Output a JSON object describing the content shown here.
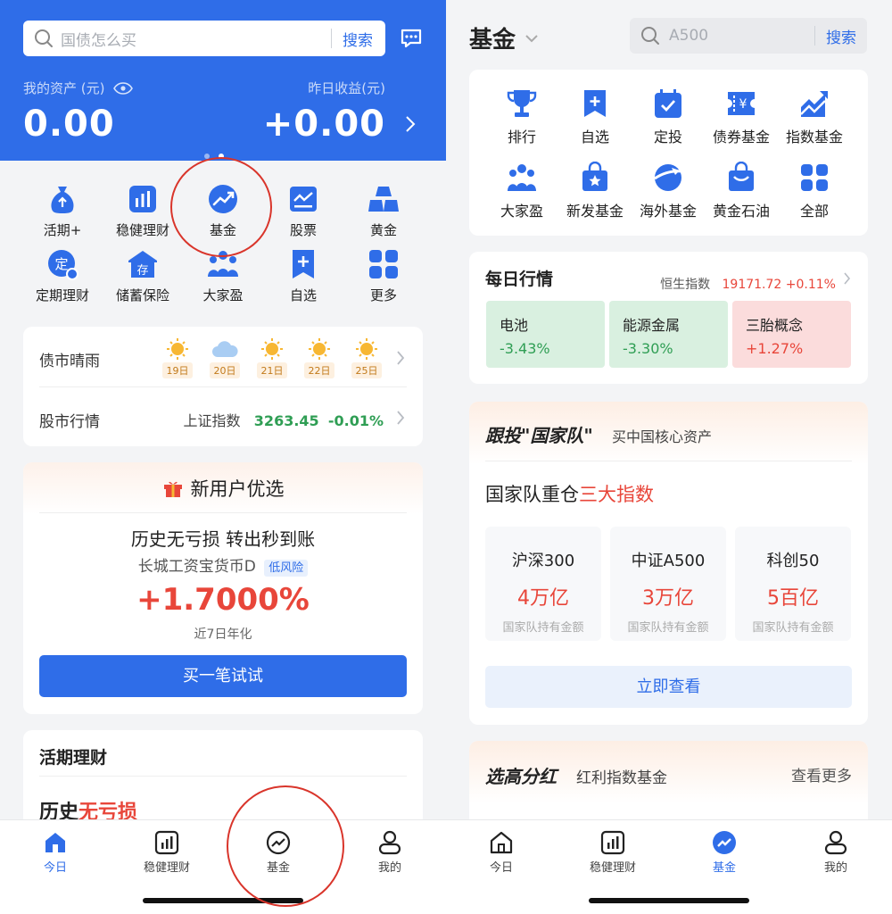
{
  "left": {
    "search": {
      "placeholder": "国债怎么买",
      "button": "搜索"
    },
    "assets": {
      "label": "我的资产 (元)",
      "value": "0.00",
      "yest_label": "昨日收益(元)",
      "yest_value": "+0.00"
    },
    "grid": [
      {
        "label": "活期+",
        "icon": "money-bag-icon"
      },
      {
        "label": "稳健理财",
        "icon": "bar-chart-icon"
      },
      {
        "label": "基金",
        "icon": "trend-icon"
      },
      {
        "label": "股票",
        "icon": "stock-chart-icon"
      },
      {
        "label": "黄金",
        "icon": "gold-bars-icon"
      },
      {
        "label": "定期理财",
        "icon": "fixed-term-icon"
      },
      {
        "label": "储蓄保险",
        "icon": "savings-house-icon"
      },
      {
        "label": "大家盈",
        "icon": "people-icon"
      },
      {
        "label": "自选",
        "icon": "bookmark-plus-icon"
      },
      {
        "label": "更多",
        "icon": "grid-more-icon"
      }
    ],
    "market": {
      "bond_label": "债市晴雨",
      "weather": [
        {
          "day": "19日",
          "w": "sunny"
        },
        {
          "day": "20日",
          "w": "cloudy"
        },
        {
          "day": "21日",
          "w": "sunny"
        },
        {
          "day": "22日",
          "w": "sunny"
        },
        {
          "day": "25日",
          "w": "sunny"
        }
      ],
      "stock_label": "股市行情",
      "index_name": "上证指数",
      "index_value": "3263.45",
      "index_change": "-0.01%"
    },
    "promo": {
      "title": "新用户优选",
      "headline": "历史无亏损 转出秒到账",
      "product": "长城工资宝货币D",
      "risk": "低风险",
      "rate": "+1.7000%",
      "rate_label": "近7日年化",
      "cta": "买一笔试试"
    },
    "current": {
      "title": "活期理财",
      "subtitle_a": "历史",
      "subtitle_b": "无亏损"
    },
    "tabs": [
      {
        "label": "今日",
        "active": true
      },
      {
        "label": "稳健理财"
      },
      {
        "label": "基金"
      },
      {
        "label": "我的"
      }
    ]
  },
  "right": {
    "title": "基金",
    "search": {
      "placeholder": "A500",
      "button": "搜索"
    },
    "grid": [
      {
        "label": "排行",
        "icon": "trophy-icon"
      },
      {
        "label": "自选",
        "icon": "bookmark-plus-icon"
      },
      {
        "label": "定投",
        "icon": "calendar-check-icon"
      },
      {
        "label": "债券基金",
        "icon": "bond-ticket-icon"
      },
      {
        "label": "指数基金",
        "icon": "index-chart-icon"
      },
      {
        "label": "大家盈",
        "icon": "people-icon"
      },
      {
        "label": "新发基金",
        "icon": "new-fund-bag-icon"
      },
      {
        "label": "海外基金",
        "icon": "globe-plane-icon"
      },
      {
        "label": "黄金石油",
        "icon": "gold-oil-bag-icon"
      },
      {
        "label": "全部",
        "icon": "grid-all-icon"
      }
    ],
    "daily": {
      "title": "每日行情",
      "index_name": "恒生指数",
      "index_value": "19171.72",
      "index_change": "+0.11%",
      "tiles": [
        {
          "name": "电池",
          "change": "-3.43%",
          "dir": "down"
        },
        {
          "name": "能源金属",
          "change": "-3.30%",
          "dir": "down"
        },
        {
          "name": "三胎概念",
          "change": "+1.27%",
          "dir": "up"
        }
      ]
    },
    "national": {
      "banner_a": "跟投\"国家队\"",
      "banner_b": "买中国核心资产",
      "heading_a": "国家队重仓",
      "heading_b": "三大指数",
      "indexes": [
        {
          "name": "沪深300",
          "value": "4万亿",
          "sub": "国家队持有金额"
        },
        {
          "name": "中证A500",
          "value": "3万亿",
          "sub": "国家队持有金额"
        },
        {
          "name": "科创50",
          "value": "5百亿",
          "sub": "国家队持有金额"
        }
      ],
      "cta": "立即查看"
    },
    "dividend": {
      "banner_a": "选高分红",
      "banner_b": "红利指数基金",
      "more": "查看更多"
    },
    "tabs": [
      {
        "label": "今日"
      },
      {
        "label": "稳健理财"
      },
      {
        "label": "基金",
        "active": true
      },
      {
        "label": "我的"
      }
    ]
  },
  "colors": {
    "primary": "#2f6de8",
    "up": "#e8463a",
    "down": "#2f9e54",
    "annotation": "#d9352b"
  }
}
